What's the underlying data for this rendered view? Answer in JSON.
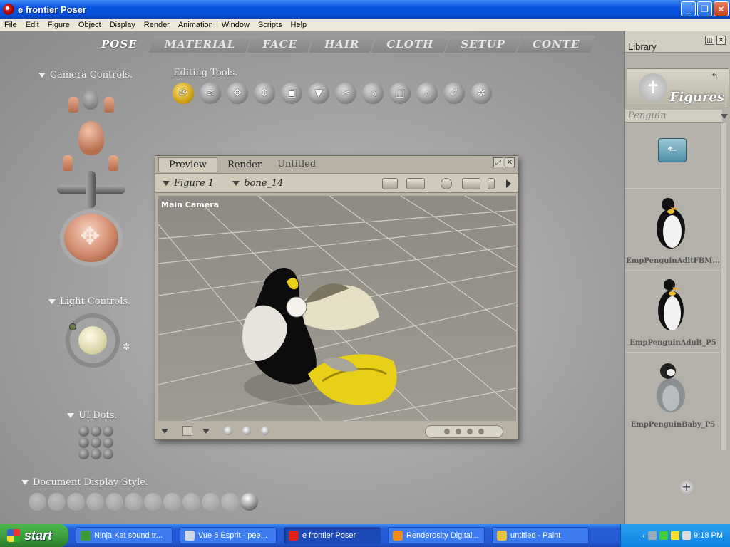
{
  "window": {
    "title": "e frontier Poser"
  },
  "menu": [
    "File",
    "Edit",
    "Figure",
    "Object",
    "Display",
    "Render",
    "Animation",
    "Window",
    "Scripts",
    "Help"
  ],
  "rooms": [
    "POSE",
    "MATERIAL",
    "FACE",
    "HAIR",
    "CLOTH",
    "SETUP",
    "CONTE"
  ],
  "panels": {
    "camera_controls": "Camera Controls.",
    "light_controls": "Light Controls.",
    "ui_dots": "UI Dots.",
    "document_display_style": "Document Display Style."
  },
  "editing_tools": {
    "label": "Editing Tools.",
    "items": [
      {
        "name": "rotate-icon",
        "glyph": "⟳"
      },
      {
        "name": "twist-icon",
        "glyph": "≋"
      },
      {
        "name": "translate-icon",
        "glyph": "✥"
      },
      {
        "name": "translate-in-out-icon",
        "glyph": "⇕"
      },
      {
        "name": "scale-icon",
        "glyph": "▣"
      },
      {
        "name": "taper-icon",
        "glyph": "▼"
      },
      {
        "name": "chain-break-icon",
        "glyph": "✂"
      },
      {
        "name": "color-icon",
        "glyph": "✎"
      },
      {
        "name": "grouping-icon",
        "glyph": "◫"
      },
      {
        "name": "view-magnifier-icon",
        "glyph": "⌕"
      },
      {
        "name": "morphing-tool-icon",
        "glyph": "✐"
      },
      {
        "name": "direct-manipulation-icon",
        "glyph": "✲"
      }
    ]
  },
  "preview": {
    "tabs": [
      "Preview",
      "Render"
    ],
    "doc_title": "Untitled",
    "figure_selector": "Figure 1",
    "actor_selector": "bone_14",
    "camera_label": "Main Camera"
  },
  "library": {
    "title": "Library",
    "category_label": "Figures",
    "subfolder": "Penguin",
    "items": [
      "EmpPenguinAdltFBM...",
      "EmpPenguinAdult_P5",
      "EmpPenguinBaby_P5"
    ]
  },
  "taskbar": {
    "start_label": "start",
    "tasks": [
      {
        "label": "Ninja Kat sound tr...",
        "color": "#3a9a3a"
      },
      {
        "label": "Vue 6 Esprit - pee...",
        "color": "#cfd6e8"
      },
      {
        "label": "e frontier Poser",
        "color": "#d22"
      },
      {
        "label": "Renderosity Digital...",
        "color": "#f08a20"
      },
      {
        "label": "untitled - Paint",
        "color": "#e8c040"
      }
    ],
    "clock": "9:18 PM"
  }
}
